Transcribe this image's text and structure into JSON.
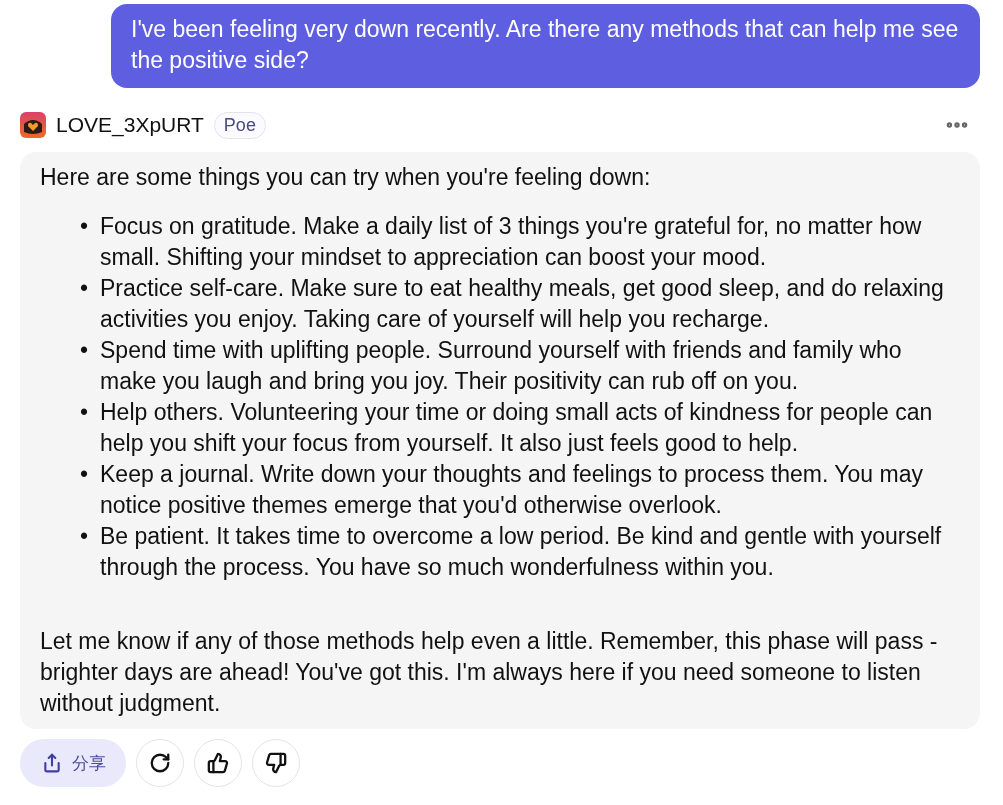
{
  "user_message": "I've been feeling very down recently. Are there any methods that can help me see the positive side?",
  "bot": {
    "name": "LOVE_3XpURT",
    "badge": "Poe"
  },
  "reply": {
    "intro": "Here are some things you can try when you're feeling down:",
    "bullets": [
      {
        "marker": "•",
        "text": "Focus on gratitude. Make a daily list of 3 things you're grateful for, no matter how small. Shifting your mindset to appreciation can boost your mood."
      },
      {
        "marker": "•",
        "text": "Practice self-care. Make sure to eat healthy meals, get good sleep, and do relaxing activities you enjoy. Taking care of yourself will help you recharge."
      },
      {
        "marker": "•",
        "text": "Spend time with uplifting people. Surround yourself with friends and family who make you laugh and bring you joy. Their positivity can rub off on you."
      },
      {
        "marker": "•",
        "text": "Help others. Volunteering your time or doing small acts of kindness for people can help you shift your focus from yourself. It also just feels good to help."
      },
      {
        "marker": "•",
        "text": "Keep a journal. Write down your thoughts and feelings to process them. You may notice positive themes emerge that you'd otherwise overlook."
      },
      {
        "marker": "•",
        "text": "Be patient. It takes time to overcome a low period. Be kind and gentle with yourself through the process. You have so much wonderfulness within you."
      }
    ],
    "outro": "Let me know if any of those methods help even a little. Remember, this phase will pass - brighter days are ahead! You've got this. I'm always here if you need someone to listen without judgment."
  },
  "actions": [
    {
      "kind": "share",
      "label": "分享"
    },
    {
      "kind": "retry"
    },
    {
      "kind": "like"
    },
    {
      "kind": "dislike"
    }
  ]
}
